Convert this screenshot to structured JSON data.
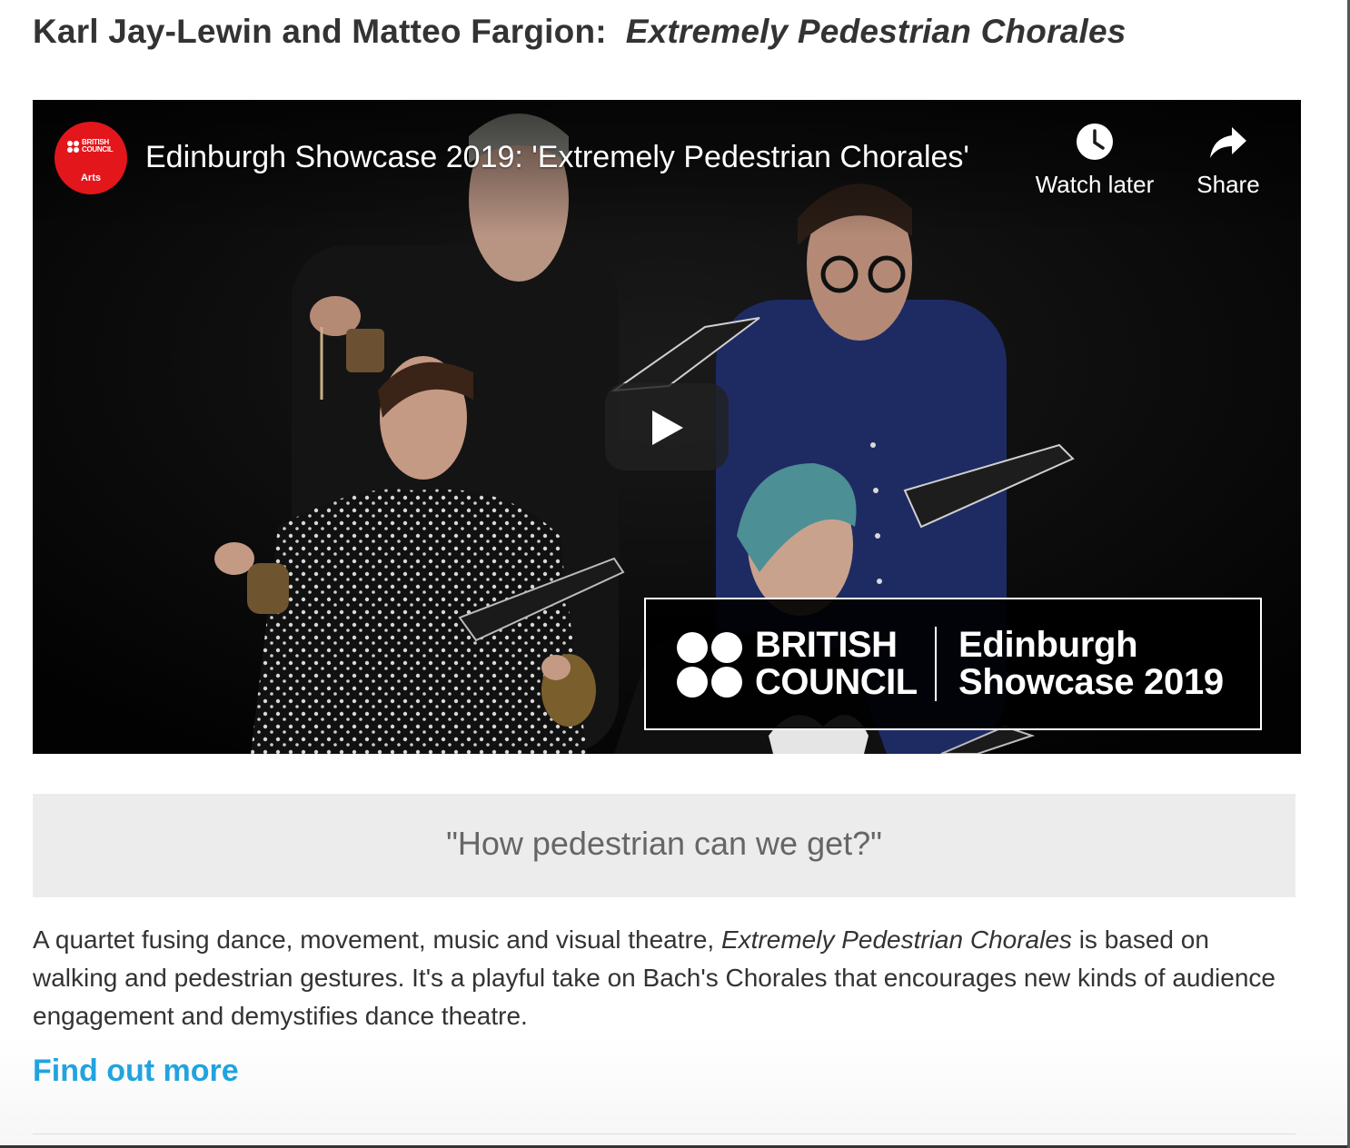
{
  "article": {
    "title_prefix": "Karl Jay-Lewin and Matteo Fargion:",
    "title_work": "Extremely Pedestrian Chorales"
  },
  "video": {
    "channel_logo_text": "BRITISH COUNCIL",
    "channel_logo_sub": "Arts",
    "title": "Edinburgh Showcase 2019: 'Extremely Pedestrian Chorales'",
    "watch_later_label": "Watch later",
    "share_label": "Share",
    "overlay_brand": "BRITISH COUNCIL",
    "overlay_event": "Edinburgh Showcase 2019"
  },
  "quote": {
    "text": "\"How pedestrian can we get?\""
  },
  "description": {
    "part1": "A quartet fusing dance, movement, music and visual theatre, ",
    "work": "Extremely Pedestrian Chorales",
    "part2": " is based on walking and pedestrian gestures. It's a playful take on Bach's Chorales that encourages new kinds of audience engagement and demystifies dance theatre."
  },
  "link": {
    "label": "Find out more"
  },
  "colors": {
    "link": "#21a3df",
    "brand_red": "#e3161c",
    "quote_bg": "#ececec",
    "text": "#333333"
  },
  "icons": {
    "play": "play-icon",
    "watch_later": "clock-icon",
    "share": "share-arrow-icon"
  }
}
